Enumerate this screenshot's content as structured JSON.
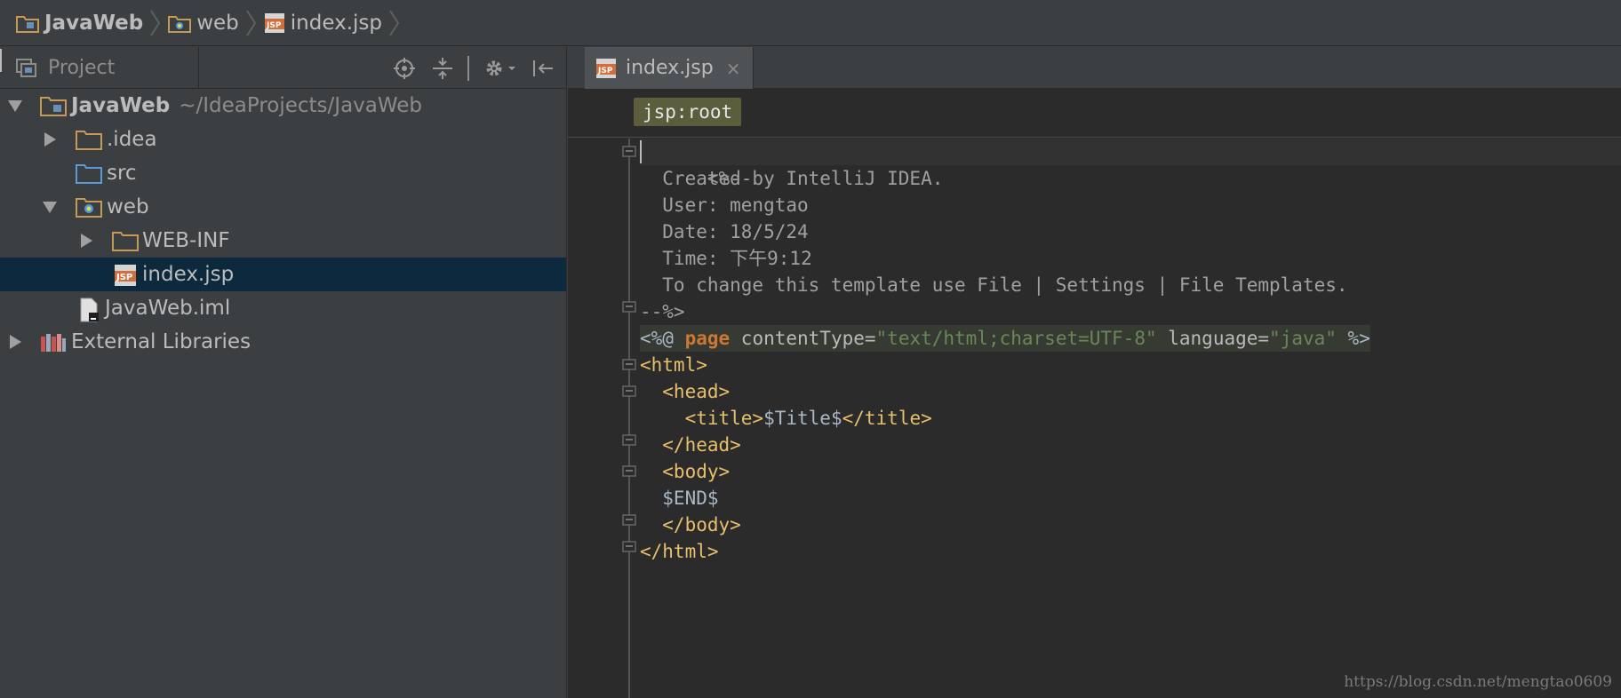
{
  "navbar": {
    "crumbs": [
      {
        "label": "JavaWeb",
        "icon": "module-folder-icon"
      },
      {
        "label": "web",
        "icon": "web-folder-icon"
      },
      {
        "label": "index.jsp",
        "icon": "jsp-file-icon"
      }
    ]
  },
  "project_panel": {
    "view_label": "Project",
    "tree": [
      {
        "label": "JavaWeb",
        "path": "~/IdeaProjects/JavaWeb",
        "icon": "module-folder-icon",
        "expanded": true
      },
      {
        "label": ".idea",
        "icon": "folder-icon",
        "expanded": false
      },
      {
        "label": "src",
        "icon": "source-folder-icon"
      },
      {
        "label": "web",
        "icon": "web-folder-icon",
        "expanded": true
      },
      {
        "label": "WEB-INF",
        "icon": "folder-icon",
        "expanded": false
      },
      {
        "label": "index.jsp",
        "icon": "jsp-file-icon",
        "selected": true
      },
      {
        "label": "JavaWeb.iml",
        "icon": "iml-file-icon"
      },
      {
        "label": "External Libraries",
        "icon": "libraries-icon",
        "expanded": false
      }
    ]
  },
  "editor": {
    "tab_label": "index.jsp",
    "tab_close": "×",
    "tag_breadcrumb": "jsp:root",
    "lines": {
      "l1": "<%--",
      "l2": "  Created by IntelliJ IDEA.",
      "l3": "  User: mengtao",
      "l4": "  Date: 18/5/24",
      "l5": "  Time: 下午9:12",
      "l6": "  To change this template use File | Settings | File Templates.",
      "l7": "--%>",
      "l8_open": "<%@ ",
      "l8_page": "page",
      "l8_attr1": " contentType=",
      "l8_val1": "\"text/html;charset=UTF-8\"",
      "l8_attr2": " language=",
      "l8_val2": "\"java\"",
      "l8_close": " %>",
      "l9": "<html>",
      "l10": "  <head>",
      "l11_indent": "    ",
      "l11_open": "<title>",
      "l11_text": "$Title$",
      "l11_close": "</title>",
      "l12": "  </head>",
      "l13": "  <body>",
      "l14": "  $END$",
      "l15": "  </body>",
      "l16": "</html>"
    }
  },
  "watermark": "https://blog.csdn.net/mengtao0609",
  "colors": {
    "background": "#3c3f41",
    "editor_background": "#2b2b2b",
    "selection": "#0d293e",
    "tag": "#e8bf6a",
    "keyword": "#cc7832",
    "string": "#6a8759"
  }
}
